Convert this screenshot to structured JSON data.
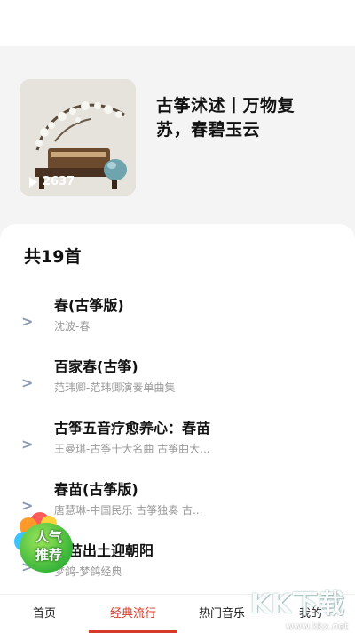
{
  "album": {
    "title": "古筝沭述丨万物复苏，春碧玉云",
    "play_count": "2637"
  },
  "list": {
    "count_label": "共19首",
    "songs": [
      {
        "name": "春(古筝版)",
        "sub": "沈波-春"
      },
      {
        "name": "百家春(古筝)",
        "sub": "范玮卿-范玮卿演奏单曲集"
      },
      {
        "name": "古筝五音疗愈养心：春苗",
        "sub": "王曼琪-古筝十大名曲 古筝曲大..."
      },
      {
        "name": "春苗(古筝版)",
        "sub": "唐慧琳-中国民乐 古筝独奏 古..."
      },
      {
        "name": "春苗出土迎朝阳",
        "sub": "梦鸽-梦鸽经典"
      }
    ],
    "arrow": ">"
  },
  "badge": {
    "line1": "人气",
    "line2": "推荐"
  },
  "tabs": [
    {
      "label": "首页",
      "active": false
    },
    {
      "label": "经典流行",
      "active": true
    },
    {
      "label": "热门音乐",
      "active": false
    },
    {
      "label": "我的",
      "active": false
    }
  ],
  "watermark": {
    "big": "KK下载",
    "small": "www.kkx.net"
  },
  "colors": {
    "accent": "#d63a2a",
    "background": "#f4f4f4",
    "panel": "#ffffff"
  }
}
